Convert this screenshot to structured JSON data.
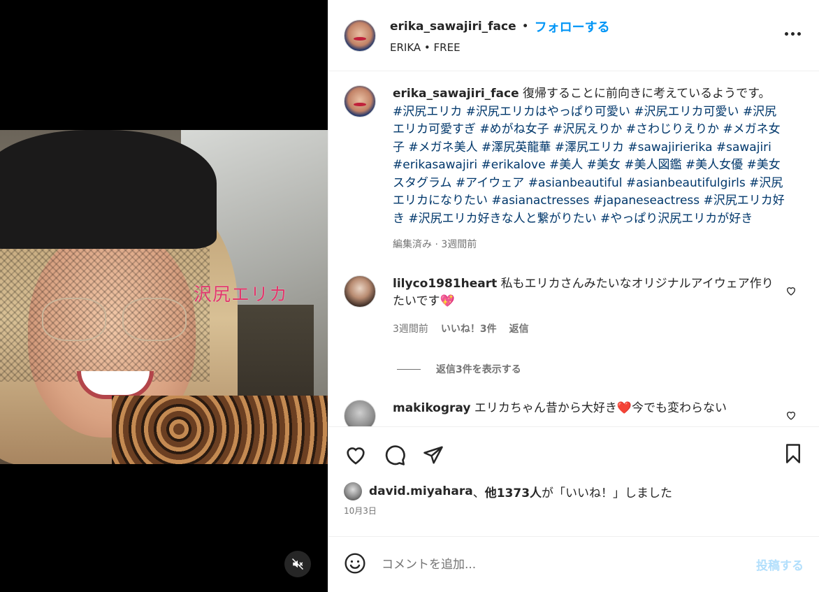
{
  "post": {
    "author": "erika_sawajiri_face",
    "follow_label": "フォローする",
    "subtitle": "ERIKA • FREE",
    "overlay_text": "沢尻エリカ",
    "caption_text": "復帰することに前向きに考えているようです。",
    "hashtags": "#沢尻エリカ #沢尻エリカはやっぱり可愛い #沢尻エリカ可愛い #沢尻エリカ可愛すぎ #めがね女子 #沢尻えりか #さわじりえりか #メガネ女子 #メガネ美人 #澤尻英龍華 #澤尻エリカ #sawajirierika #sawajiri #erikasawajiri #erikalove #美人 #美女 #美人図鑑 #美人女優 #美女スタグラム #アイウェア #asianbeautiful #asianbeautifulgirls #沢尻エリカになりたい #asianactresses #japaneseactress #沢尻エリカ好き #沢尻エリカ好きな人と繋がりたい #やっぱり沢尻エリカが好き",
    "caption_meta": "編集済み · 3週間前"
  },
  "comments": [
    {
      "username": "lilyco1981heart",
      "text": "私もエリカさんみたいなオリジナルアイウェア作りたいです💖",
      "time": "3週間前",
      "likes": "いいね！3件",
      "reply": "返信"
    },
    {
      "username": "makikogray",
      "text": "エリカちゃん昔から大好き❤️今でも変わらない"
    }
  ],
  "view_replies": "返信3件を表示する",
  "likes": {
    "first_user": "david.miyahara",
    "separator": "、",
    "others": "他1373人",
    "suffix": "が「いいね！」しました"
  },
  "date": "10月3日",
  "comment_input": {
    "placeholder": "コメントを追加...",
    "post_label": "投稿する"
  },
  "colors": {
    "accent": "#0095f6",
    "hashtag": "#00376b",
    "muted": "#737373"
  }
}
